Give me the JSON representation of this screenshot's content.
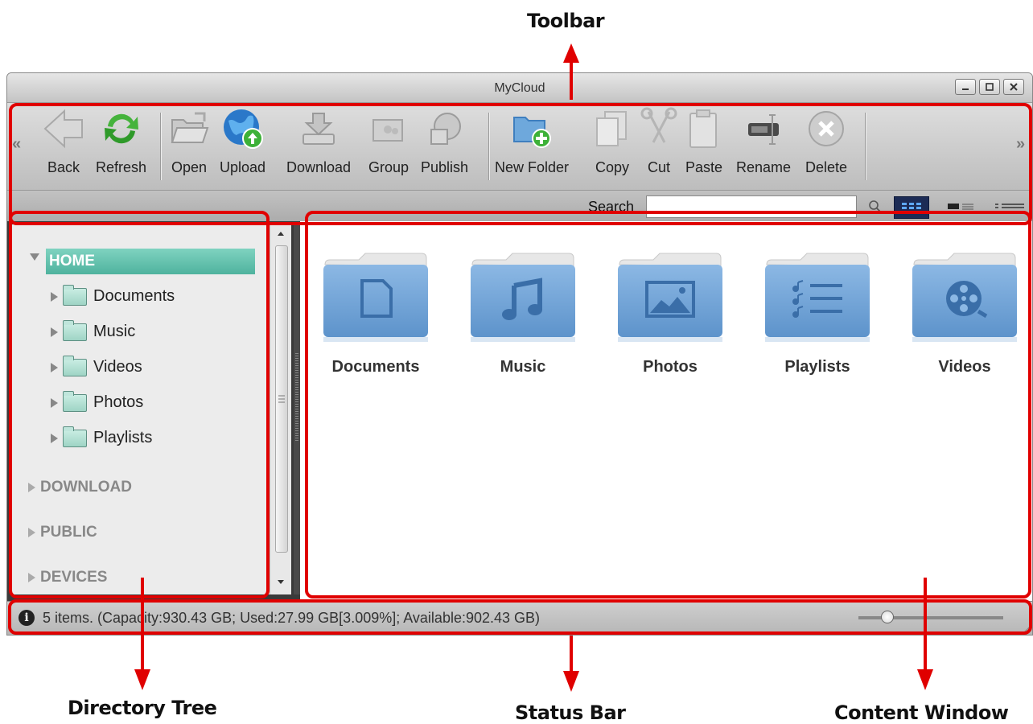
{
  "callouts": {
    "toolbar": "Toolbar",
    "directory_tree": "Directory Tree",
    "status_bar": "Status Bar",
    "content_window": "Content Window"
  },
  "window": {
    "title": "MyCloud",
    "buttons": [
      "minimize",
      "maximize",
      "close"
    ]
  },
  "toolbar": {
    "scroll_left": "«",
    "scroll_right": "»",
    "buttons": [
      {
        "label": "Back",
        "icon": "back-arrow-icon"
      },
      {
        "label": "Refresh",
        "icon": "refresh-icon"
      },
      {
        "label": "Open",
        "icon": "open-folder-icon"
      },
      {
        "label": "Upload",
        "icon": "upload-globe-icon"
      },
      {
        "label": "Download",
        "icon": "download-icon"
      },
      {
        "label": "Group",
        "icon": "group-icon"
      },
      {
        "label": "Publish",
        "icon": "publish-icon"
      },
      {
        "label": "New Folder",
        "icon": "new-folder-icon"
      },
      {
        "label": "Copy",
        "icon": "copy-icon"
      },
      {
        "label": "Cut",
        "icon": "scissors-icon"
      },
      {
        "label": "Paste",
        "icon": "clipboard-icon"
      },
      {
        "label": "Rename",
        "icon": "rename-icon"
      },
      {
        "label": "Delete",
        "icon": "delete-icon"
      }
    ],
    "search_label": "Search",
    "search_value": "",
    "views": [
      "grid-view-icon",
      "detail-view-icon",
      "list-view-icon"
    ]
  },
  "tree": {
    "home": "HOME",
    "home_children": [
      "Documents",
      "Music",
      "Videos",
      "Photos",
      "Playlists"
    ],
    "roots": [
      "DOWNLOAD",
      "PUBLIC",
      "DEVICES"
    ]
  },
  "content": {
    "folders": [
      {
        "label": "Documents",
        "icon": "document-icon"
      },
      {
        "label": "Music",
        "icon": "music-note-icon"
      },
      {
        "label": "Photos",
        "icon": "photo-icon"
      },
      {
        "label": "Playlists",
        "icon": "playlist-icon"
      },
      {
        "label": "Videos",
        "icon": "film-reel-icon"
      }
    ]
  },
  "status": {
    "text": "5 items. (Capacity:930.43 GB; Used:27.99 GB[3.009%]; Available:902.43 GB)",
    "zoom_fraction": 0.2
  },
  "colors": {
    "highlight": "#e00000",
    "home_selection": "#5cbfa9",
    "folder_blue": "#6f9fd0"
  }
}
